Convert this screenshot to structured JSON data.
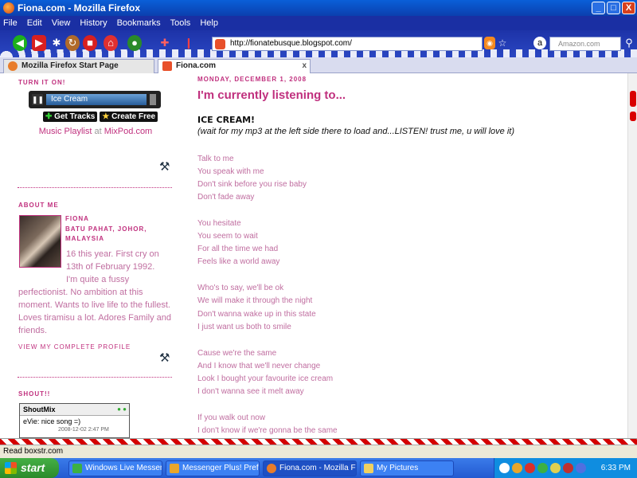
{
  "window": {
    "title": "Fiona.com - Mozilla Firefox",
    "minimize": "_",
    "maximize": "□",
    "close": "X"
  },
  "menu": [
    "File",
    "Edit",
    "View",
    "History",
    "Bookmarks",
    "Tools",
    "Help"
  ],
  "toolbar": {
    "url": "http://fionatebusque.blogspot.com/",
    "search_placeholder": "Amazon.com"
  },
  "tabs": [
    {
      "label": "Mozilla Firefox Start Page"
    },
    {
      "label": "Fiona.com"
    }
  ],
  "sidebar": {
    "turn_it_on": "TURN IT ON!",
    "player_track": "Ice Cream",
    "get_tracks": "Get Tracks",
    "create_free": "Create Free",
    "playlist_prefix": "Music Playlist",
    "playlist_at": "at",
    "playlist_site": "MixPod.com",
    "about_heading": "ABOUT ME",
    "profile_name": "FIONA",
    "profile_location": "BATU PAHAT, JOHOR, MALAYSIA",
    "about_line1": "16 this year. First cry on",
    "about_line2": "13th of February 1992.",
    "about_line3": "I'm quite a fussy",
    "about_rest": "perfectionist. No ambition at this moment. Wants to live life to the fullest. Loves tiramisu a lot. Adores Family and friends.",
    "view_profile": "VIEW MY COMPLETE PROFILE",
    "shout_heading": "SHOUT!!",
    "shoutbox_title": "ShoutMix",
    "shout_message": "eVie: nice song =)",
    "shout_date": "2008-12-02 2:47 PM"
  },
  "post": {
    "date": "MONDAY, DECEMBER 1, 2008",
    "title": "I'm currently listening to...",
    "song": "ICE CREAM!",
    "note": "(wait for my mp3 at the left side there to load and...LISTEN! trust me, u will love it)",
    "lyrics": [
      "Talk to me",
      "You speak with me",
      "Don't sink before you rise baby",
      "Don't fade away",
      "You hesitate",
      "You seem to wait",
      "For all the time we had",
      "Feels like a world away",
      "Who's to say, we'll be ok",
      "We will make it through the night",
      "Don't wanna wake up in this state",
      "I just want us both to smile",
      "Cause we're the same",
      "And I know that we'll never change",
      "Look I bought your favourite ice cream",
      "I don't wanna see it melt away",
      "If you walk out now",
      "I don't know if we're gonna be the same"
    ]
  },
  "status": "Read boxstr.com",
  "taskbar": {
    "start": "start",
    "tasks": [
      {
        "label": "Windows Live Messen..."
      },
      {
        "label": "Messenger Plus! Pref..."
      },
      {
        "label": "Fiona.com - Mozilla Fi..."
      },
      {
        "label": "My Pictures"
      }
    ],
    "clock": "6:33 PM"
  },
  "colors": {
    "accent_pink": "#c0307e",
    "lyric_pink": "#c06ea0",
    "theme_blue": "#1a2fa3"
  }
}
